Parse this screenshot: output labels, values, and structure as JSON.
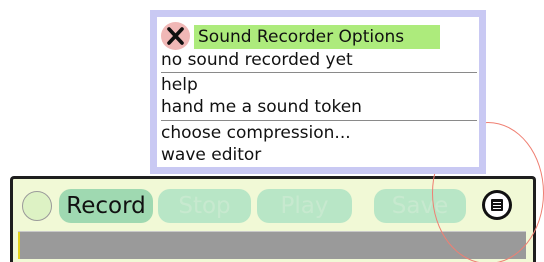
{
  "menu": {
    "title": "Sound Recorder Options",
    "items": [
      {
        "label": "no sound recorded yet"
      },
      {
        "label": "help"
      },
      {
        "label": "hand me a sound token"
      },
      {
        "label": "choose compression..."
      },
      {
        "label": "wave editor"
      }
    ]
  },
  "recorder": {
    "buttons": {
      "record": "Record",
      "stop": "Stop",
      "play": "Play",
      "save": "Save"
    },
    "icons": {
      "close": "close-x-icon",
      "menu": "menu-handle-icon"
    },
    "colors": {
      "panel": "#f1f9d6",
      "button": "#9fd9b1",
      "button_disabled": "#b8e6c6",
      "menu_border": "#c9c9f3",
      "title_highlight": "#adeb7c",
      "halo": "#ef7f72"
    }
  }
}
